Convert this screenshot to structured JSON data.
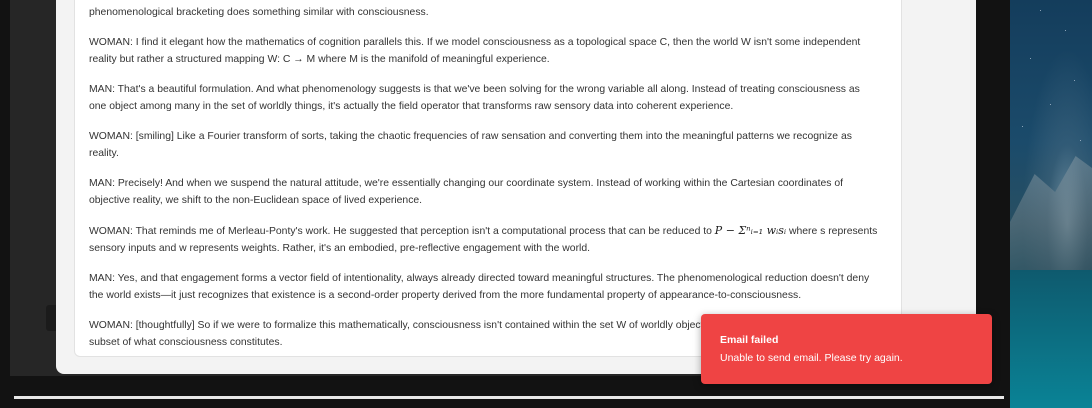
{
  "transcript": {
    "lines": [
      {
        "text": "phenomenological bracketing does something similar with consciousness."
      },
      {
        "text": "WOMAN: I find it elegant how the mathematics of cognition parallels this. If we model consciousness as a topological space C, then the world W isn't some independent reality but rather a structured mapping W: C → M where M is the manifold of meaningful experience."
      },
      {
        "text": "MAN: That's a beautiful formulation. And what phenomenology suggests is that we've been solving for the wrong variable all along. Instead of treating consciousness as one object among many in the set of worldly things, it's actually the field operator that transforms raw sensory data into coherent experience."
      },
      {
        "text": "WOMAN: [smiling] Like a Fourier transform of sorts, taking the chaotic frequencies of raw sensation and converting them into the meaningful patterns we recognize as reality."
      },
      {
        "text": "MAN: Precisely! And when we suspend the natural attitude, we're essentially changing our coordinate system. Instead of working within the Cartesian coordinates of objective reality, we shift to the non-Euclidean space of lived experience."
      },
      {
        "text_before": "WOMAN: That reminds me of Merleau-Ponty's work. He suggested that perception isn't a computational process that can be reduced to ",
        "formula": "P − Σⁿᵢ₌₁ wᵢsᵢ",
        "text_after": " where s represents sensory inputs and w represents weights. Rather, it's an embodied, pre-reflective engagement with the world."
      },
      {
        "text": "MAN: Yes, and that engagement forms a vector field of intentionality, always already directed toward meaningful structures. The phenomenological reduction doesn't deny the world exists—it just recognizes that existence is a second-order property derived from the more fundamental property of appearance-to-consciousness."
      },
      {
        "text": "WOMAN: [thoughtfully] So if we were to formalize this mathematically, consciousness isn't contained within the set W of worldly objects but rather the world is a proper subset of what consciousness constitutes."
      }
    ]
  },
  "toast": {
    "title": "Email failed",
    "message": "Unable to send email. Please try again.",
    "color": "#ef4444"
  }
}
